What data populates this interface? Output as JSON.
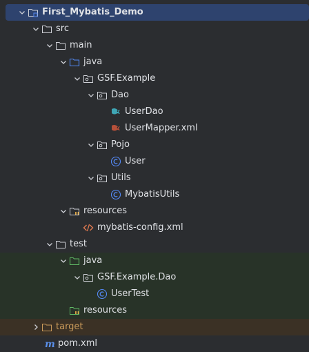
{
  "tree": {
    "root": "First_Mybatis_Demo",
    "src": "src",
    "main": "main",
    "main_java": "java",
    "package_main": "GSF.Example",
    "dao": "Dao",
    "user_dao": "UserDao",
    "user_mapper": "UserMapper.xml",
    "pojo": "Pojo",
    "user": "User",
    "utils": "Utils",
    "mybatis_utils": "MybatisUtils",
    "main_resources": "resources",
    "mybatis_config": "mybatis-config.xml",
    "test": "test",
    "test_java": "java",
    "package_test": "GSF.Example.Dao",
    "user_test": "UserTest",
    "test_resources": "resources",
    "target": "target",
    "pom": "pom.xml"
  },
  "colors": {
    "background": "#2b2d30",
    "selected_row": "#2e436e",
    "test_row": "#283328",
    "excluded_row": "#3b3125",
    "text": "#dfe1e5",
    "excluded_text": "#c99a5a",
    "source_folder": "#548af7",
    "test_folder": "#5fb865",
    "class_icon": "#548af7",
    "xml_icon": "#e0794f",
    "maven_icon": "#5a8fe8"
  }
}
